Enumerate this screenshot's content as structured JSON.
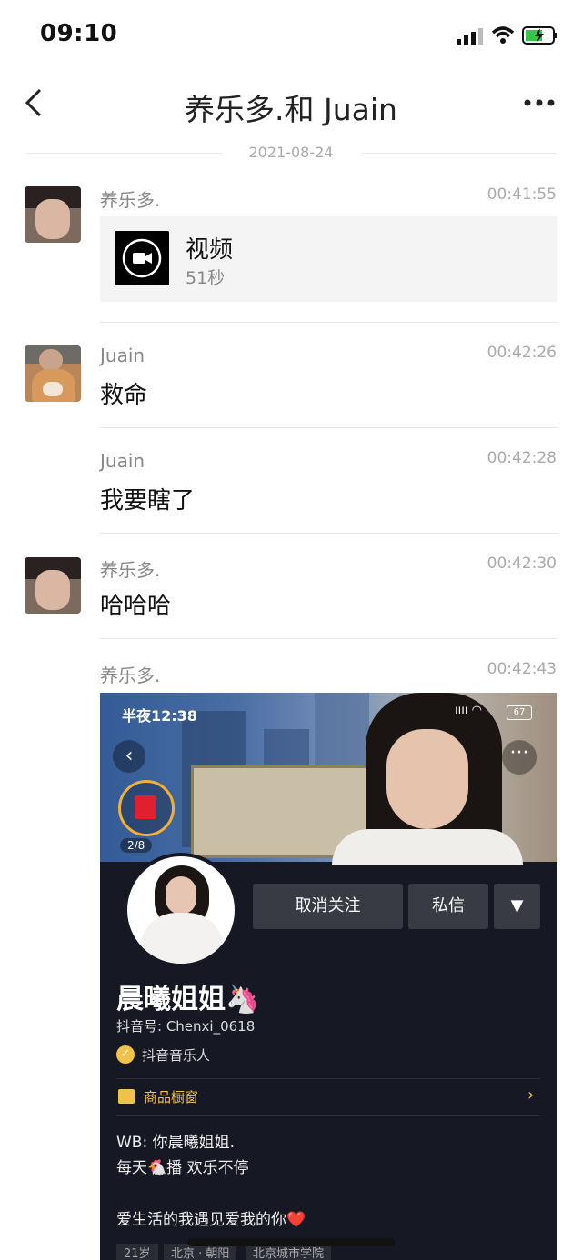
{
  "status_bar": {
    "time": "09:10"
  },
  "nav": {
    "title": "养乐多.和 Juain"
  },
  "date_divider": "2021-08-24",
  "messages": [
    {
      "sender": "养乐多.",
      "time": "00:41:55",
      "video_title": "视频",
      "video_duration": "51秒"
    },
    {
      "sender": "Juain",
      "time": "00:42:26",
      "text": "救命"
    },
    {
      "sender": "Juain",
      "time": "00:42:28",
      "text": "我要瞎了"
    },
    {
      "sender": "养乐多.",
      "time": "00:42:30",
      "text": "哈哈哈"
    },
    {
      "sender": "养乐多.",
      "time": "00:42:43"
    }
  ],
  "shared_screenshot": {
    "status_time": "半夜12:38",
    "battery": "67",
    "coin_progress": "2/8",
    "unfollow_label": "取消关注",
    "message_label": "私信",
    "profile_name": "晨曦姐姐🦄",
    "douyin_id": "抖音号: Chenxi_0618",
    "badge": "抖音音乐人",
    "shop_window": "商品橱窗",
    "bio_line1": "WB: 你晨曦姐姐.",
    "bio_line2": "每天🐔播  欢乐不停",
    "bio_line3": "爱生活的我遇见爱我的你❤️",
    "tags": [
      "21岁",
      "北京 · 朝阳",
      "北京城市学院"
    ]
  },
  "icons": {
    "back": "chevron-left-icon",
    "more": "more-dots-icon",
    "video": "video-camera-icon"
  }
}
